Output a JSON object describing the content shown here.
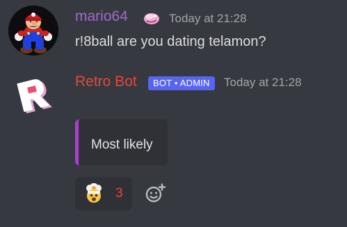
{
  "messages": [
    {
      "username": "mario64",
      "timestamp": "Today at 21:28",
      "content": "r!8ball are you dating telamon?",
      "avatar_icon": "mario-avatar-icon",
      "status_icon": "pink-bubble-emoji-icon",
      "username_color": "#a06ad2"
    },
    {
      "username": "Retro Bot",
      "timestamp": "Today at 21:28",
      "tag": "BOT • ADMIN",
      "avatar_icon": "roblox-r-logo-icon",
      "username_color": "#e8473c",
      "embed": {
        "text": "Most likely",
        "accent_color": "#b03bd3"
      },
      "reactions": [
        {
          "emoji_icon": "exploding-head-emoji-icon",
          "count": "3"
        }
      ],
      "add_reaction_icon": "add-reaction-icon"
    }
  ],
  "colors": {
    "background": "#36393f",
    "embed_background": "#2f3136",
    "tag_background": "#5865f2",
    "timestamp": "#a3a6aa"
  }
}
